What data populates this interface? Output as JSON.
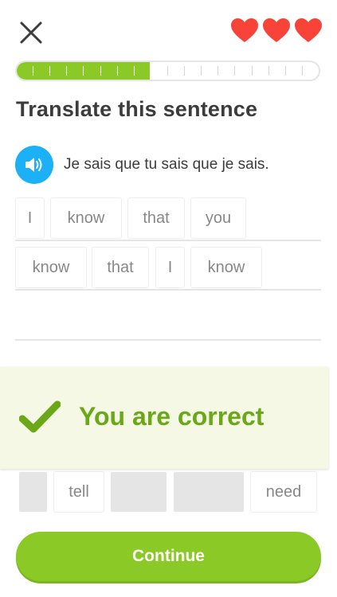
{
  "header": {
    "close_icon": "close-icon",
    "hearts": [
      "heart-icon",
      "heart-icon",
      "heart-icon"
    ],
    "heart_color": "#f74338"
  },
  "progress": {
    "value": 0.44,
    "total_segments": 18,
    "filled_segments": 8,
    "fill_color": "#8ac926"
  },
  "exercise": {
    "title": "Translate this sentence",
    "speaker_icon": "speaker-icon",
    "sentence": "Je sais que tu sais que je sais."
  },
  "answer": {
    "row1": [
      "I",
      "know",
      "that",
      "you"
    ],
    "row2": [
      "know",
      "that",
      "I",
      "know"
    ]
  },
  "word_bank": {
    "visible": [
      "",
      "tell",
      "",
      "",
      "need"
    ]
  },
  "feedback": {
    "icon": "checkmark-icon",
    "message": "You are correct",
    "color": "#6aa818",
    "background": "#f4f8e4"
  },
  "continue_label": "Continue"
}
